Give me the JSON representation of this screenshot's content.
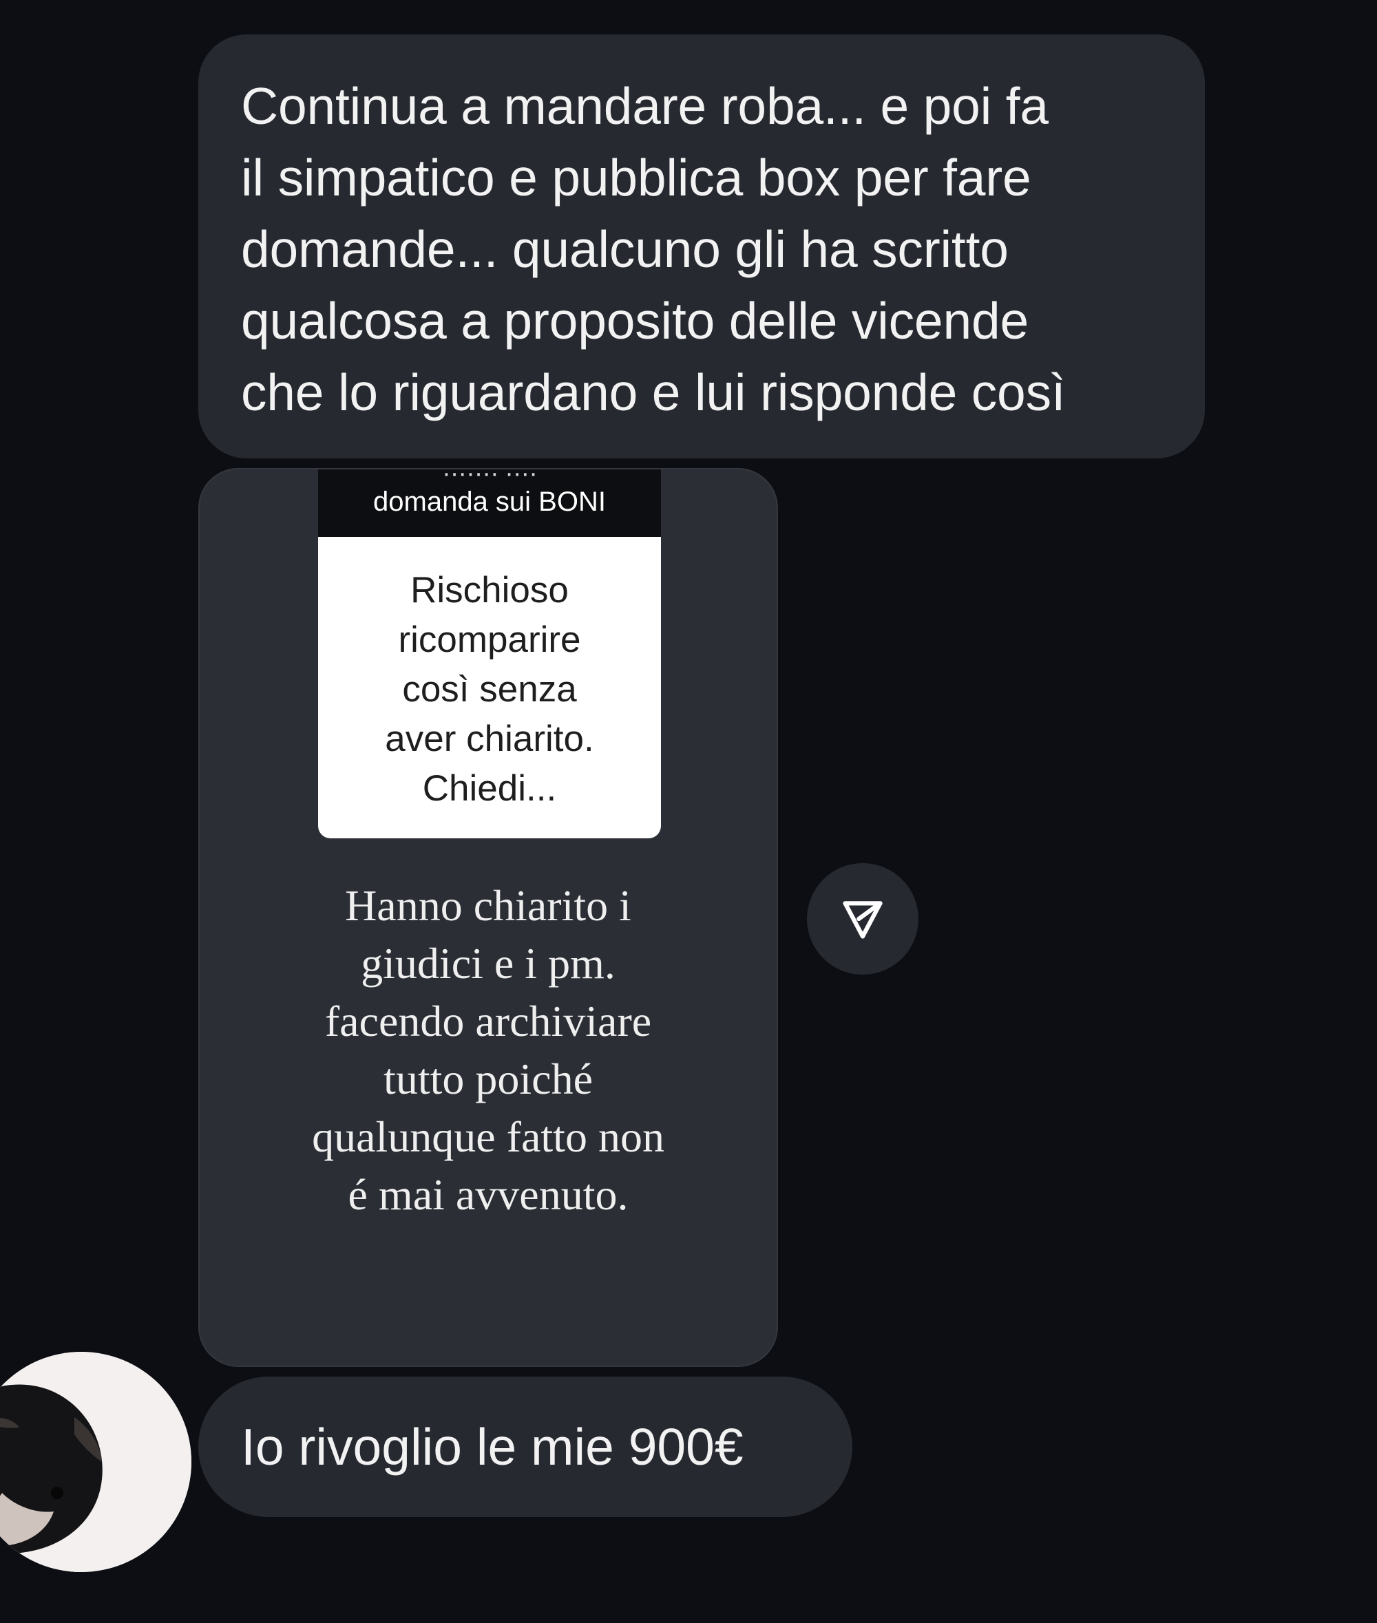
{
  "messages": [
    {
      "id": "msg-1",
      "text": "Continua a mandare roba... e poi fa\nil simpatico e pubblica box per fare\ndomande... qualcuno gli ha scritto\nqualcosa a proposito delle vicende\nche lo riguardano e lui risponde così"
    },
    {
      "id": "story-card",
      "header_top_fragment": "·······  ····",
      "header_label": "domanda sui BONI",
      "question": "Rischioso\nricomparire\ncosì senza\naver chiarito.\nChiedi...",
      "answer": "Hanno chiarito i\ngiudici e i pm.\nfacendo archiviare\ntutto poiché\nqualunque fatto non\né mai avvenuto."
    },
    {
      "id": "msg-3",
      "text": "Io rivoglio le mie 900€"
    }
  ],
  "share_button": {
    "icon": "send-paper-plane-icon"
  },
  "avatar": {
    "icon": "guinea-pig-avatar"
  },
  "colors": {
    "background": "#0c0e13",
    "bubble": "#262930",
    "text": "#f2f2f2"
  }
}
